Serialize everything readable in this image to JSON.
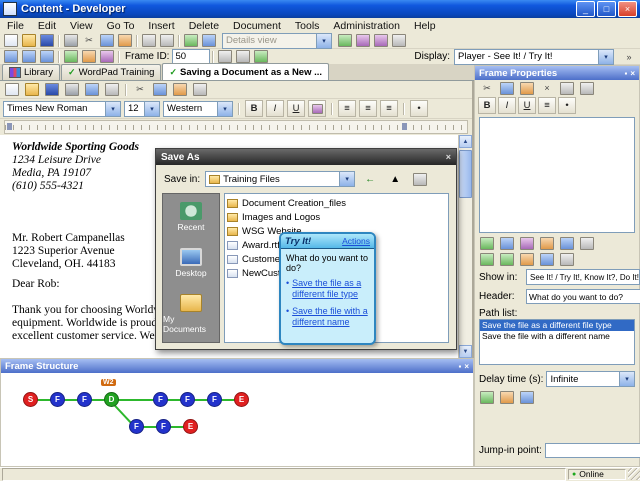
{
  "window": {
    "title": "Content - Developer"
  },
  "menu": {
    "items": [
      "File",
      "Edit",
      "View",
      "Go To",
      "Insert",
      "Delete",
      "Document",
      "Tools",
      "Administration",
      "Help"
    ]
  },
  "toolbars": {
    "details_view": "Details view",
    "frame_id_label": "Frame ID:",
    "frame_id_value": "50",
    "display_label": "Display:",
    "display_value": "Player - See It! / Try It!"
  },
  "tabs": [
    {
      "label": "Library"
    },
    {
      "label": "WordPad Training"
    },
    {
      "label": "Saving a Document as a New ..."
    }
  ],
  "wordpad": {
    "font_name": "Times New Roman",
    "font_size": "12",
    "script": "Western",
    "document": {
      "lines": [
        "Worldwide Sporting Goods",
        "1234 Leisure Drive",
        "Media, PA 19107",
        "(610) 555-4321",
        "Mr. Robert Campanellas",
        "1223 Superior Avenue",
        "Cleveland, OH. 44183",
        "Dear Rob:",
        "Thank you for choosing Worldwide",
        "equipment. Worldwide is proud of",
        "excellent customer service. We have"
      ]
    }
  },
  "save_dialog": {
    "title": "Save As",
    "save_in_label": "Save in:",
    "save_in_value": "Training Files",
    "places": [
      {
        "label": "Recent"
      },
      {
        "label": "Desktop"
      },
      {
        "label": "My Documents"
      }
    ],
    "files": [
      {
        "name": "Document Creation_files"
      },
      {
        "name": "Images and Logos"
      },
      {
        "name": "WSG Website"
      },
      {
        "name": "Award.rtf"
      },
      {
        "name": "Customer.rtf"
      },
      {
        "name": "NewCustomer.rt..."
      }
    ]
  },
  "tryit": {
    "title": "Try It!",
    "actions_label": "Actions",
    "question": "What do you want to do?",
    "options": [
      {
        "label": "Save the file as a different file type"
      },
      {
        "label": "Save the file with a different name"
      }
    ]
  },
  "frame_properties": {
    "title": "Frame Properties",
    "show_in_label": "Show in:",
    "show_in_value": "See It! / Try It!, Know It?, Do It!",
    "header_label": "Header:",
    "header_value": "What do you want to do?",
    "path_list_label": "Path list:",
    "path_items": [
      {
        "label": "Save the file as a different file type"
      },
      {
        "label": "Save the file with a different name"
      }
    ],
    "delay_label": "Delay time (s):",
    "delay_value": "Infinite",
    "jump_in_label": "Jump-in point:"
  },
  "frame_structure": {
    "title": "Frame Structure",
    "badge": "W2",
    "main_nodes": [
      {
        "label": "S",
        "color": "#e02020"
      },
      {
        "label": "F",
        "color": "#2333cc"
      },
      {
        "label": "F",
        "color": "#2333cc"
      },
      {
        "label": "D",
        "color": "#21a121"
      },
      {
        "label": "F",
        "color": "#2333cc"
      },
      {
        "label": "F",
        "color": "#2333cc"
      },
      {
        "label": "F",
        "color": "#2333cc"
      },
      {
        "label": "E",
        "color": "#e02020"
      }
    ],
    "branch_nodes": [
      {
        "label": "F",
        "color": "#2333cc"
      },
      {
        "label": "F",
        "color": "#2333cc"
      },
      {
        "label": "E",
        "color": "#e02020"
      }
    ]
  },
  "format": {
    "bold": "B",
    "italic": "I",
    "underline": "U"
  },
  "status_bar": {
    "online_label": "Online"
  },
  "icons": {
    "check": "✓",
    "close": "×",
    "minimize": "_",
    "maximize": "□",
    "chevron_down": "▾",
    "chevron_right": "»",
    "arrow_up": "▲",
    "arrow_down": "▼",
    "arrow_left": "←",
    "scissors": "✂",
    "bullet": "•",
    "dot": "●",
    "pin": "▪",
    "align": "≡"
  },
  "colors": {
    "titlebar_blue": "#1058de",
    "panel_header_blue": "#4d6fc9",
    "selection_blue": "#316ac5",
    "tryit_border": "#2e86c0",
    "node_red": "#e02020",
    "node_blue": "#2333cc",
    "node_green": "#21a121",
    "edge_green": "#2db82d"
  }
}
